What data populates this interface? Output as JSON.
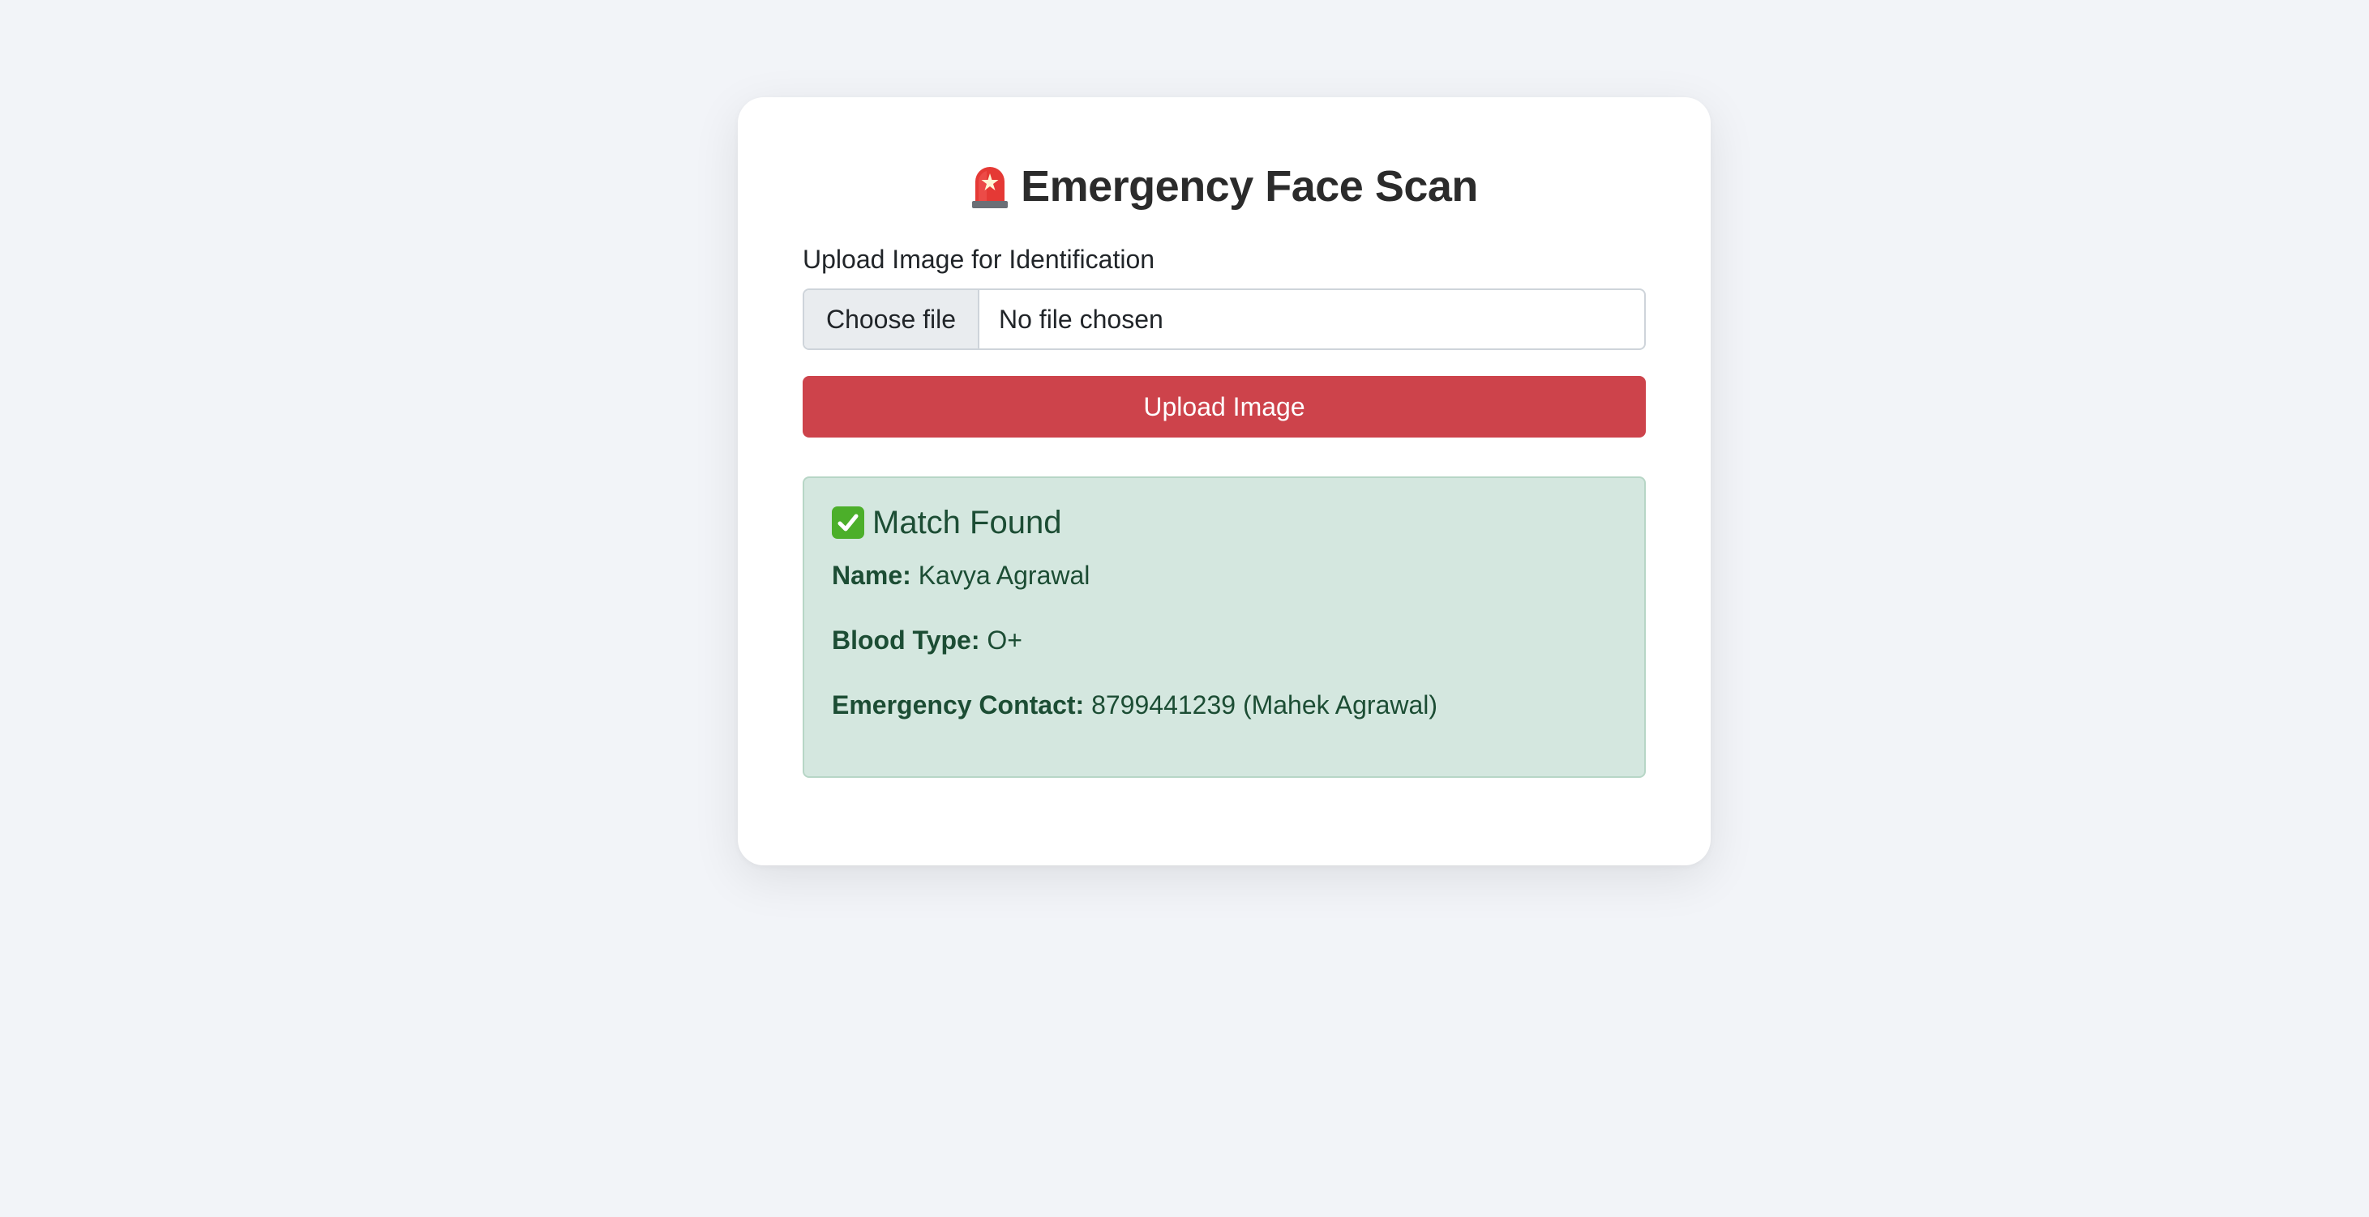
{
  "header": {
    "title": "Emergency Face Scan",
    "icon": "siren-icon"
  },
  "upload": {
    "label": "Upload Image for Identification",
    "choose_file_label": "Choose file",
    "file_status": "No file chosen",
    "submit_label": "Upload Image"
  },
  "result": {
    "icon": "check-mark-icon",
    "title": "Match Found",
    "fields": [
      {
        "label": "Name:",
        "value": "Kavya Agrawal"
      },
      {
        "label": "Blood Type:",
        "value": "O+"
      },
      {
        "label": "Emergency Contact:",
        "value": "8799441239 (Mahek Agrawal)"
      }
    ]
  },
  "colors": {
    "page_background": "#f2f4f8",
    "card_background": "#ffffff",
    "primary_button": "#cd434b",
    "success_background": "#d4e7df",
    "success_text": "#1c4d34",
    "success_border": "#b7d6c6"
  }
}
